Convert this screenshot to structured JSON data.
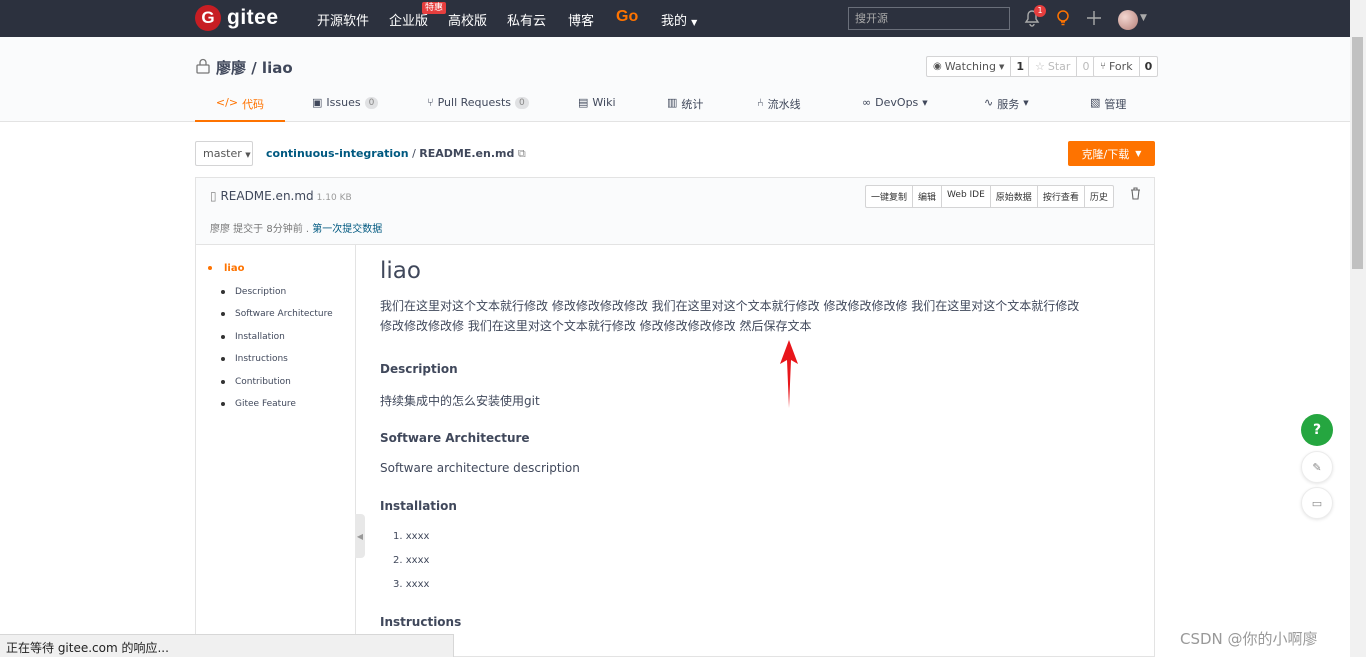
{
  "topbar": {
    "brand": "gitee",
    "nav": [
      "开源软件",
      "企业版",
      "高校版",
      "私有云",
      "博客"
    ],
    "hot_badge": "特惠",
    "go": "Go",
    "me": "我的",
    "search_placeholder": "搜开源",
    "notification_count": "1"
  },
  "repo": {
    "title": "廖廖 / liao",
    "watch_label": "Watching",
    "watch_count": "1",
    "star_label": "Star",
    "star_count": "0",
    "fork_label": "Fork",
    "fork_count": "0"
  },
  "tabs": [
    {
      "label": "代码"
    },
    {
      "label": "Issues",
      "count": "0"
    },
    {
      "label": "Pull Requests",
      "count": "0"
    },
    {
      "label": "Wiki"
    },
    {
      "label": "统计"
    },
    {
      "label": "流水线"
    },
    {
      "label": "DevOps"
    },
    {
      "label": "服务"
    },
    {
      "label": "管理"
    }
  ],
  "branch": "master",
  "path": {
    "dir": "continuous-integration",
    "sep": "/",
    "file": "README.en.md"
  },
  "clone_button": "克隆/下载",
  "file": {
    "name": "README.en.md",
    "size": "1.10 KB",
    "commit_prefix": "廖廖 提交于 8分钟前 .",
    "commit_msg": "第一次提交数据",
    "actions": [
      "一键复制",
      "编辑",
      "Web IDE",
      "原始数据",
      "按行查看",
      "历史"
    ]
  },
  "toc": [
    "liao",
    "Description",
    "Software Architecture",
    "Installation",
    "Instructions",
    "Contribution",
    "Gitee Feature"
  ],
  "readme": {
    "h1": "liao",
    "intro_line1": "我们在这里对这个文本就行修改 修改修改修改修改 我们在这里对这个文本就行修改 修改修改修改修 我们在这里对这个文本就行修改",
    "intro_line2": "修改修改修改修 我们在这里对这个文本就行修改 修改修改修改修改 然后保存文本",
    "desc_h": "Description",
    "desc_p": "持续集成中的怎么安装使用git",
    "arch_h": "Software Architecture",
    "arch_p": "Software architecture description",
    "install_h": "Installation",
    "install_items": [
      "xxxx",
      "xxxx",
      "xxxx"
    ],
    "instr_h": "Instructions"
  },
  "status_bar": "正在等待 gitee.com 的响应...",
  "watermark": "CSDN @你的小啊廖",
  "colors": {
    "accent": "#fe7300",
    "topbar": "#2c313e",
    "link": "#005980",
    "help": "#25a640"
  }
}
